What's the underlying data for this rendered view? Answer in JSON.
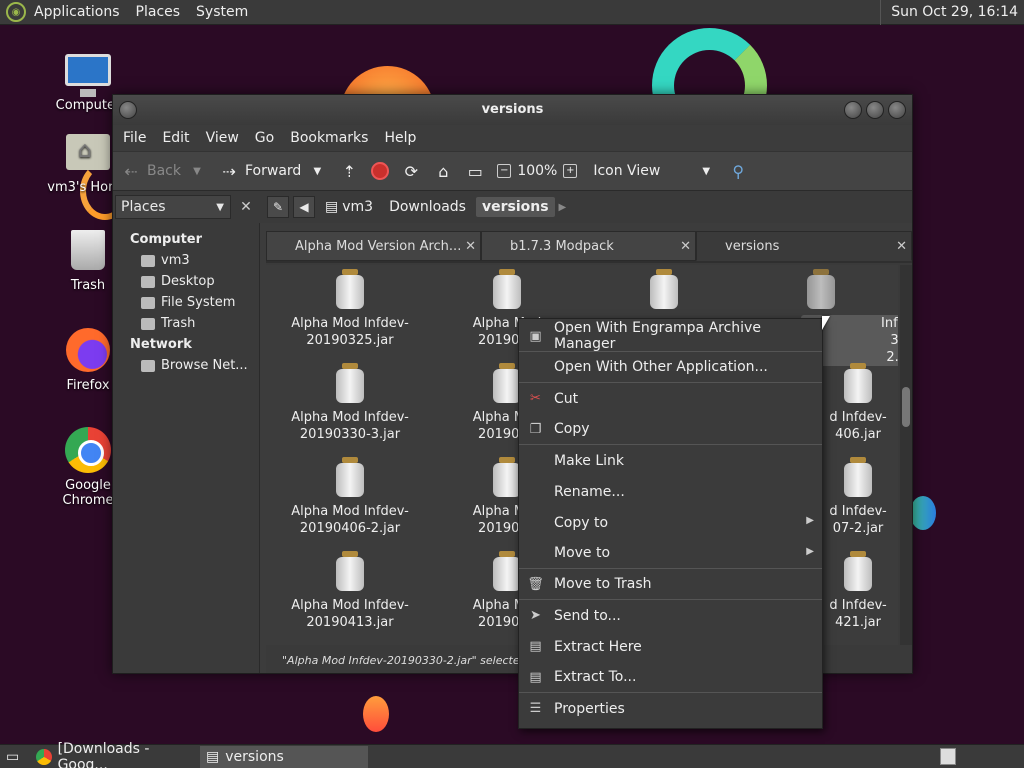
{
  "top_panel": {
    "menus": [
      "Applications",
      "Places",
      "System"
    ],
    "clock": "Sun Oct 29, 16:14"
  },
  "desktop": {
    "icons": [
      {
        "label": "Computer",
        "icon": "computer-icon"
      },
      {
        "label": "vm3's Home",
        "icon": "home-folder-icon"
      },
      {
        "label": "Trash",
        "icon": "trash-icon"
      },
      {
        "label": "Firefox",
        "icon": "firefox-icon"
      },
      {
        "label": "Google Chrome",
        "icon": "chrome-icon"
      }
    ]
  },
  "window": {
    "title": "versions",
    "menu": [
      "File",
      "Edit",
      "View",
      "Go",
      "Bookmarks",
      "Help"
    ],
    "toolbar": {
      "back": "Back",
      "forward": "Forward",
      "zoom": "100%",
      "view_mode": "Icon View"
    },
    "places_label": "Places",
    "breadcrumbs": [
      "vm3",
      "Downloads",
      "versions"
    ],
    "sidebar": {
      "computer_header": "Computer",
      "computer_items": [
        "vm3",
        "Desktop",
        "File System",
        "Trash"
      ],
      "network_header": "Network",
      "network_items": [
        "Browse Net..."
      ]
    },
    "tabs": [
      {
        "label": "Alpha Mod Version Arch..."
      },
      {
        "label": "b1.7.3 Modpack"
      },
      {
        "label": "versions"
      }
    ],
    "files": [
      {
        "line1": "Alpha Mod Infdev-",
        "line2": "20190325.jar"
      },
      {
        "line1": "Alpha Mod",
        "line2": "2019032"
      },
      {
        "line1": "",
        "line2": ""
      },
      {
        "line1": "Infdev-",
        "line2": "30-2.jar"
      },
      {
        "line1": "Alpha Mod Infdev-",
        "line2": "20190330-3.jar"
      },
      {
        "line1": "Alpha Mod",
        "line2": "2019033"
      },
      {
        "line1": "d Infdev-",
        "line2": "406.jar"
      },
      {
        "line1": "Alpha Mod Infdev-",
        "line2": "20190406-2.jar"
      },
      {
        "line1": "Alpha Mod",
        "line2": "2019040"
      },
      {
        "line1": "d Infdev-",
        "line2": "07-2.jar"
      },
      {
        "line1": "Alpha Mod Infdev-",
        "line2": "20190413.jar"
      },
      {
        "line1": "Alpha Mod",
        "line2": "2019041"
      },
      {
        "line1": "d Infdev-",
        "line2": "421.jar"
      }
    ],
    "status": "\"Alpha Mod Infdev-20190330-2.jar\" selected (1.5"
  },
  "context_menu": {
    "items": [
      {
        "label": "Open With Engrampa Archive Manager",
        "icon": "archive-manager-icon"
      },
      {
        "label": "Open With Other Application...",
        "icon": ""
      },
      {
        "label": "Cut",
        "icon": "scissors-icon"
      },
      {
        "label": "Copy",
        "icon": "copy-icon"
      },
      {
        "label": "Make Link",
        "icon": ""
      },
      {
        "label": "Rename...",
        "icon": ""
      },
      {
        "label": "Copy to",
        "icon": ""
      },
      {
        "label": "Move to",
        "icon": ""
      },
      {
        "label": "Move to Trash",
        "icon": "trash-icon"
      },
      {
        "label": "Send to...",
        "icon": "send-icon"
      },
      {
        "label": "Extract Here",
        "icon": "extract-icon"
      },
      {
        "label": "Extract To...",
        "icon": "extract-icon"
      },
      {
        "label": "Properties",
        "icon": "properties-icon"
      }
    ]
  },
  "bottom_panel": {
    "tasks": [
      "[Downloads - Goog...",
      "versions"
    ]
  }
}
